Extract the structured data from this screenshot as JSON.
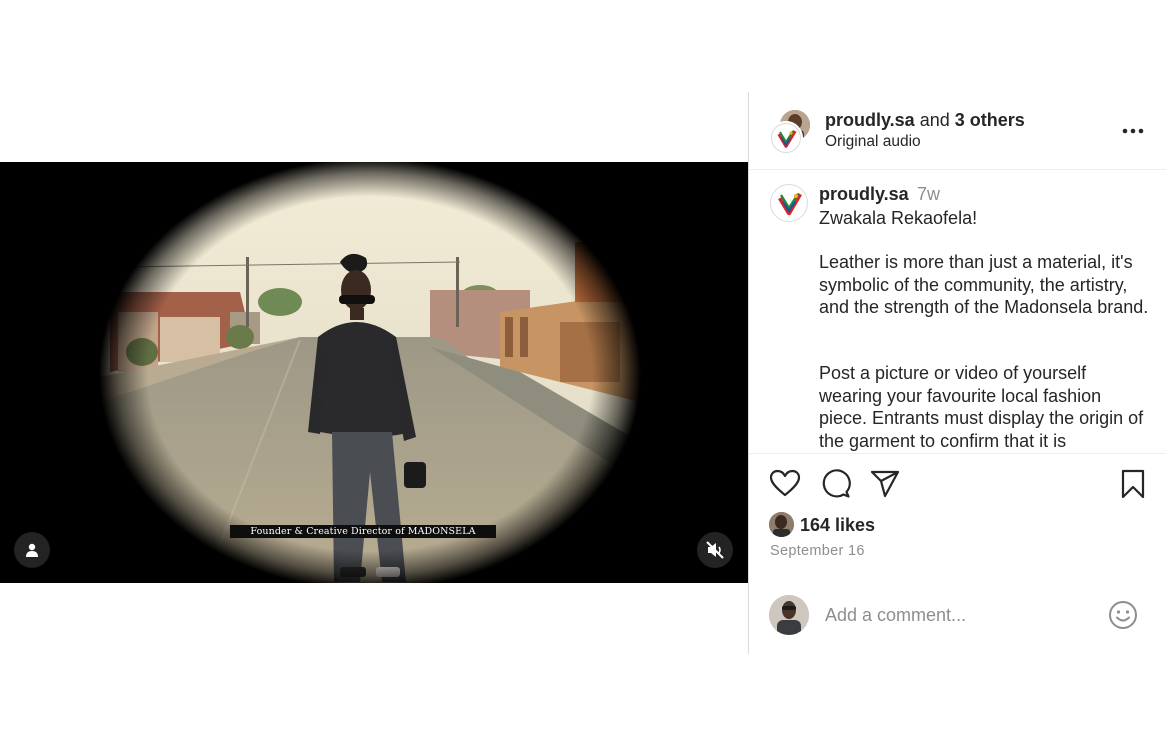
{
  "video": {
    "caption": "Founder & Creative Director of MADONSELA",
    "tag_icon": "user-icon",
    "mute_icon": "speaker-muted-icon"
  },
  "header": {
    "username": "proudly.sa",
    "joiner": "and",
    "others": "3 others",
    "audio": "Original audio",
    "more_icon": "more-dots-icon"
  },
  "caption": {
    "username": "proudly.sa",
    "time": "7w",
    "greeting": "Zwakala Rekaofela!",
    "paragraph1": "Leather is more than just a material, it's symbolic of the community, the artistry, and the strength of the Madonsela brand.",
    "paragraph2": "Post a picture or video of yourself wearing your favourite local fashion piece. Entrants must display the origin of the garment to confirm that it is"
  },
  "actions": {
    "like_icon": "heart-icon",
    "comment_icon": "comment-icon",
    "share_icon": "paper-plane-icon",
    "save_icon": "bookmark-icon"
  },
  "likes": {
    "text": "164 likes"
  },
  "date": "September 16",
  "comment": {
    "placeholder": "Add a comment...",
    "emoji_icon": "smiley-icon"
  },
  "colors": {
    "text": "#262626",
    "secondary_text": "#8e8e8e",
    "divider": "#dbdbdb",
    "logo_red": "#d7262a",
    "logo_green": "#1f8a3d",
    "logo_blue": "#1c4f9c",
    "logo_yellow": "#f2b21c"
  }
}
